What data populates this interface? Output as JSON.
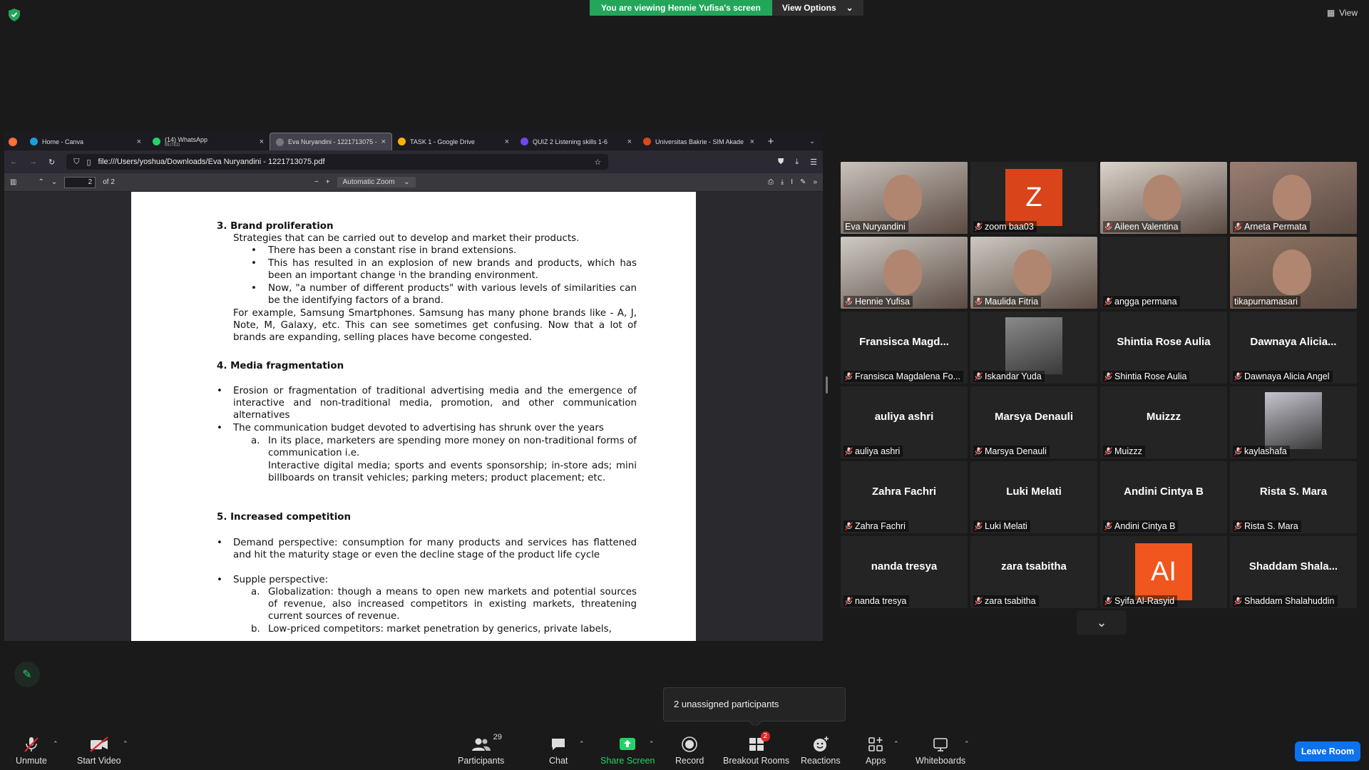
{
  "banner": {
    "viewing_text": "You are viewing Hennie Yufisa's screen",
    "view_options": "View Options",
    "view_label": "View"
  },
  "browser": {
    "tabs": [
      {
        "title": "Home - Canva",
        "subtitle": "",
        "color": "#1aa0d6"
      },
      {
        "title": "(14) WhatsApp",
        "subtitle": "MUTED",
        "color": "#25d366"
      },
      {
        "title": "Eva Nuryandini - 1221713075 - Eva",
        "subtitle": "",
        "color": "#777777"
      },
      {
        "title": "TASK 1 - Google Drive",
        "subtitle": "",
        "color": "#f4b400"
      },
      {
        "title": "QUIZ 2 Listening skills 1-6",
        "subtitle": "",
        "color": "#6f48eb"
      },
      {
        "title": "Universitas Bakrie - SIM Akade",
        "subtitle": "",
        "color": "#d84a1b"
      }
    ],
    "url": "file:///Users/yoshua/Downloads/Eva Nuryandini - 1221713075.pdf",
    "page_number": "2",
    "page_total": "of 2",
    "zoom_label": "Automatic Zoom"
  },
  "document": {
    "s3_title": "3.   Brand proliferation",
    "s3_intro": "Strategies that can be carried out to develop and market their products.",
    "s3_b1": "There has been a constant rise in brand extensions.",
    "s3_b2": "This has resulted in an explosion of new brands and products, which has been an important change in the branding environment.",
    "s3_b3": "Now, \"a number of different products\" with various levels of similarities can be the identifying factors of a brand.",
    "s3_example": "For example, Samsung Smartphones. Samsung has many phone brands like - A, J, Note, M, Galaxy, etc. This can see sometimes get confusing. Now that a lot of brands are expanding, selling places have become congested.",
    "s4_title": "4.   Media fragmentation",
    "s4_b1": "Erosion or fragmentation of traditional advertising media and the emergence of interactive and non-traditional media, promotion, and other communication alternatives",
    "s4_b2": "The communication budget devoted to advertising has shrunk over the years",
    "s4_a_mark": "a.",
    "s4_a": "In its place, marketers are spending more money on non-traditional forms of communication i.e.",
    "s4_a2": "Interactive digital media; sports and events sponsorship; in-store ads; mini billboards on transit vehicles; parking meters; product placement; etc.",
    "s5_title": "5.   Increased competition",
    "s5_b1": "Demand perspective: consumption for many products and services has flattened and hit the maturity stage or even the decline stage of the product life cycle",
    "s5_b2": "Supple perspective:",
    "s5_a_mark": "a.",
    "s5_a": "Globalization: though a means to open new markets and potential sources of revenue, also increased competitors in existing markets, threatening current sources of revenue.",
    "s5_b_mark": "b.",
    "s5_b": "Low-priced competitors: market penetration by generics, private labels,",
    "bullet": "•"
  },
  "participants": [
    {
      "label": "Eva Nuryandini",
      "center": "",
      "kind": "video",
      "muted": false,
      "speaking": true,
      "bg": "#c9c2bb"
    },
    {
      "label": "zoom baa03",
      "center": "",
      "kind": "avatar",
      "avatar_text": "Z",
      "avatar_color": "#d9441a",
      "muted": true
    },
    {
      "label": "Aileen Valentina",
      "center": "",
      "kind": "video",
      "muted": true,
      "bg": "#dcd4cc"
    },
    {
      "label": "Arneta Permata",
      "center": "",
      "kind": "video",
      "muted": true,
      "bg": "#9a7e73"
    },
    {
      "label": "Hennie Yufisa",
      "center": "",
      "kind": "video",
      "muted": true,
      "bg": "#cfcbc4"
    },
    {
      "label": "Maulida Fitria",
      "center": "",
      "kind": "video",
      "muted": true,
      "bg": "#cdc8c0"
    },
    {
      "label": "angga permana",
      "center": "",
      "kind": "blank",
      "muted": true
    },
    {
      "label": "tikapurnamasari",
      "center": "",
      "kind": "video",
      "muted": false,
      "bg": "#8f7462"
    },
    {
      "label": "Fransisca Magdalena Fo...",
      "center": "Fransisca  Magd...",
      "kind": "name",
      "muted": true
    },
    {
      "label": "Iskandar Yuda",
      "center": "",
      "kind": "thumb",
      "muted": true,
      "bg": "#8a8a8a"
    },
    {
      "label": "Shintia Rose Aulia",
      "center": "Shintia Rose Aulia",
      "kind": "name",
      "muted": true
    },
    {
      "label": "Dawnaya Alicia Angel",
      "center": "Dawnaya  Alicia...",
      "kind": "name",
      "muted": true
    },
    {
      "label": "auliya ashri",
      "center": "auliya ashri",
      "kind": "name",
      "muted": true
    },
    {
      "label": "Marsya Denauli",
      "center": "Marsya Denauli",
      "kind": "name",
      "muted": true
    },
    {
      "label": "Muizzz",
      "center": "Muizzz",
      "kind": "name",
      "muted": true
    },
    {
      "label": "kaylashafa",
      "center": "",
      "kind": "thumb",
      "muted": true,
      "bg": "#c7c4cf"
    },
    {
      "label": "Zahra Fachri",
      "center": "Zahra Fachri",
      "kind": "name",
      "muted": true
    },
    {
      "label": "Luki Melati",
      "center": "Luki Melati",
      "kind": "name",
      "muted": true
    },
    {
      "label": "Andini Cintya B",
      "center": "Andini Cintya B",
      "kind": "name",
      "muted": true
    },
    {
      "label": "Rista S. Mara",
      "center": "Rista S. Mara",
      "kind": "name",
      "muted": true
    },
    {
      "label": "nanda tresya",
      "center": "nanda tresya",
      "kind": "name",
      "muted": true
    },
    {
      "label": "zara tsabitha",
      "center": "zara tsabitha",
      "kind": "name",
      "muted": true
    },
    {
      "label": "Syifa Al-Rasyid",
      "center": "",
      "kind": "avatar",
      "avatar_text": "AI",
      "avatar_color": "#f0561d",
      "muted": true
    },
    {
      "label": "Shaddam Shalahuddin",
      "center": "Shaddam  Shala...",
      "kind": "name",
      "muted": true
    }
  ],
  "popup": {
    "unassigned": "2 unassigned participants"
  },
  "toolbar": {
    "unmute": "Unmute",
    "start_video": "Start Video",
    "participants": "Participants",
    "participants_count": "29",
    "chat": "Chat",
    "share_screen": "Share Screen",
    "record": "Record",
    "breakout_rooms": "Breakout Rooms",
    "breakout_badge": "2",
    "reactions": "Reactions",
    "apps": "Apps",
    "whiteboards": "Whiteboards",
    "leave": "Leave Room"
  },
  "colors": {
    "accent_green": "#23a55a",
    "leave_blue": "#0e72ed",
    "speaker_outline": "#d9e842",
    "mute_red": "#e02828"
  }
}
